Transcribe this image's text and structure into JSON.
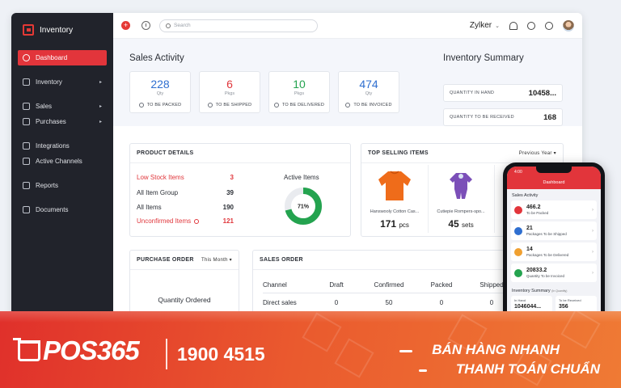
{
  "sidebar": {
    "brand": "Inventory",
    "items": [
      {
        "label": "Dashboard",
        "caret": ""
      },
      {
        "label": "Inventory",
        "caret": "▸"
      },
      {
        "label": "Sales",
        "caret": "▸"
      },
      {
        "label": "Purchases",
        "caret": "▸"
      },
      {
        "label": "Integrations",
        "caret": ""
      },
      {
        "label": "Active Channels",
        "caret": ""
      },
      {
        "label": "Reports",
        "caret": ""
      },
      {
        "label": "Documents",
        "caret": ""
      }
    ]
  },
  "topbar": {
    "search_placeholder": "Search",
    "org": "Zylker",
    "dropdown": "⌄"
  },
  "sales_activity": {
    "title": "Sales Activity",
    "cards": [
      {
        "value": "228",
        "unit": "Qty",
        "label": "TO BE PACKED"
      },
      {
        "value": "6",
        "unit": "Pkgs",
        "label": "TO BE SHIPPED"
      },
      {
        "value": "10",
        "unit": "Pkgs",
        "label": "TO BE DELIVERED"
      },
      {
        "value": "474",
        "unit": "Qty",
        "label": "TO BE INVOICED"
      }
    ]
  },
  "inventory_summary": {
    "title": "Inventory Summary",
    "rows": [
      {
        "label": "QUANTITY IN HAND",
        "value": "10458..."
      },
      {
        "label": "QUANTITY TO BE RECEIVED",
        "value": "168"
      }
    ]
  },
  "product_details": {
    "title": "PRODUCT DETAILS",
    "rows": [
      {
        "label": "Low Stock Items",
        "value": "3"
      },
      {
        "label": "All Item Group",
        "value": "39"
      },
      {
        "label": "All Items",
        "value": "190"
      },
      {
        "label": "Unconfirmed Items",
        "value": "121"
      }
    ],
    "active_items_title": "Active Items",
    "active_items_percent": 71,
    "active_items_label": "71%"
  },
  "top_selling": {
    "title": "TOP SELLING ITEMS",
    "filter": "Previous Year",
    "items": [
      {
        "name": "Hanswooly Cotton Cas...",
        "qty": "171",
        "unit": "pcs"
      },
      {
        "name": "Cutiepie Rompers-spo...",
        "qty": "45",
        "unit": "sets"
      }
    ]
  },
  "purchase_order": {
    "title": "PURCHASE ORDER",
    "filter": "This Month",
    "qty_label": "Quantity Ordered"
  },
  "sales_order": {
    "title": "SALES ORDER",
    "columns": [
      "Channel",
      "Draft",
      "Confirmed",
      "Packed",
      "Shipped"
    ],
    "rows": [
      [
        "Direct sales",
        "0",
        "50",
        "0",
        "0"
      ]
    ]
  },
  "phone": {
    "time": "4:00",
    "title": "Dashboard",
    "sales_title": "Sales Activity",
    "cards": [
      {
        "value": "466.2",
        "label": "To be Packed",
        "color": "#e2353b"
      },
      {
        "value": "21",
        "label": "Packages To be Shipped",
        "color": "#2f6fd0"
      },
      {
        "value": "14",
        "label": "Packages To be Delivered",
        "color": "#f0a030"
      },
      {
        "value": "20833.2",
        "label": "Quantity To be Invoiced",
        "color": "#24a34f"
      }
    ],
    "inv_title": "Inventory Summary",
    "inv_title_note": "(In Quantity)",
    "inv": [
      {
        "label": "In Hand",
        "value": "1046044..."
      },
      {
        "label": "To be Received",
        "value": "356"
      }
    ]
  },
  "banner": {
    "logo": "POS365",
    "hotline": "1900 4515",
    "slogan_1": "BÁN HÀNG NHANH",
    "slogan_2": "THANH TOÁN CHUẨN"
  },
  "colors": {
    "accent": "#e2353b",
    "blue": "#2f6fd0",
    "green": "#24a34f",
    "sidebar": "#21232b"
  }
}
